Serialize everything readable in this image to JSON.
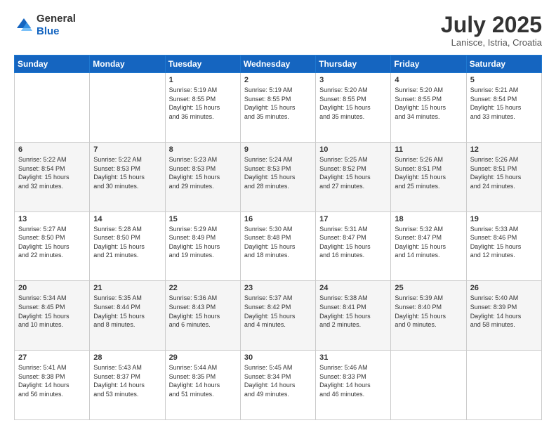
{
  "header": {
    "logo_general": "General",
    "logo_blue": "Blue",
    "month_year": "July 2025",
    "location": "Lanisce, Istria, Croatia"
  },
  "weekdays": [
    "Sunday",
    "Monday",
    "Tuesday",
    "Wednesday",
    "Thursday",
    "Friday",
    "Saturday"
  ],
  "weeks": [
    [
      {
        "day": "",
        "lines": []
      },
      {
        "day": "",
        "lines": []
      },
      {
        "day": "1",
        "lines": [
          "Sunrise: 5:19 AM",
          "Sunset: 8:55 PM",
          "Daylight: 15 hours",
          "and 36 minutes."
        ]
      },
      {
        "day": "2",
        "lines": [
          "Sunrise: 5:19 AM",
          "Sunset: 8:55 PM",
          "Daylight: 15 hours",
          "and 35 minutes."
        ]
      },
      {
        "day": "3",
        "lines": [
          "Sunrise: 5:20 AM",
          "Sunset: 8:55 PM",
          "Daylight: 15 hours",
          "and 35 minutes."
        ]
      },
      {
        "day": "4",
        "lines": [
          "Sunrise: 5:20 AM",
          "Sunset: 8:55 PM",
          "Daylight: 15 hours",
          "and 34 minutes."
        ]
      },
      {
        "day": "5",
        "lines": [
          "Sunrise: 5:21 AM",
          "Sunset: 8:54 PM",
          "Daylight: 15 hours",
          "and 33 minutes."
        ]
      }
    ],
    [
      {
        "day": "6",
        "lines": [
          "Sunrise: 5:22 AM",
          "Sunset: 8:54 PM",
          "Daylight: 15 hours",
          "and 32 minutes."
        ]
      },
      {
        "day": "7",
        "lines": [
          "Sunrise: 5:22 AM",
          "Sunset: 8:53 PM",
          "Daylight: 15 hours",
          "and 30 minutes."
        ]
      },
      {
        "day": "8",
        "lines": [
          "Sunrise: 5:23 AM",
          "Sunset: 8:53 PM",
          "Daylight: 15 hours",
          "and 29 minutes."
        ]
      },
      {
        "day": "9",
        "lines": [
          "Sunrise: 5:24 AM",
          "Sunset: 8:53 PM",
          "Daylight: 15 hours",
          "and 28 minutes."
        ]
      },
      {
        "day": "10",
        "lines": [
          "Sunrise: 5:25 AM",
          "Sunset: 8:52 PM",
          "Daylight: 15 hours",
          "and 27 minutes."
        ]
      },
      {
        "day": "11",
        "lines": [
          "Sunrise: 5:26 AM",
          "Sunset: 8:51 PM",
          "Daylight: 15 hours",
          "and 25 minutes."
        ]
      },
      {
        "day": "12",
        "lines": [
          "Sunrise: 5:26 AM",
          "Sunset: 8:51 PM",
          "Daylight: 15 hours",
          "and 24 minutes."
        ]
      }
    ],
    [
      {
        "day": "13",
        "lines": [
          "Sunrise: 5:27 AM",
          "Sunset: 8:50 PM",
          "Daylight: 15 hours",
          "and 22 minutes."
        ]
      },
      {
        "day": "14",
        "lines": [
          "Sunrise: 5:28 AM",
          "Sunset: 8:50 PM",
          "Daylight: 15 hours",
          "and 21 minutes."
        ]
      },
      {
        "day": "15",
        "lines": [
          "Sunrise: 5:29 AM",
          "Sunset: 8:49 PM",
          "Daylight: 15 hours",
          "and 19 minutes."
        ]
      },
      {
        "day": "16",
        "lines": [
          "Sunrise: 5:30 AM",
          "Sunset: 8:48 PM",
          "Daylight: 15 hours",
          "and 18 minutes."
        ]
      },
      {
        "day": "17",
        "lines": [
          "Sunrise: 5:31 AM",
          "Sunset: 8:47 PM",
          "Daylight: 15 hours",
          "and 16 minutes."
        ]
      },
      {
        "day": "18",
        "lines": [
          "Sunrise: 5:32 AM",
          "Sunset: 8:47 PM",
          "Daylight: 15 hours",
          "and 14 minutes."
        ]
      },
      {
        "day": "19",
        "lines": [
          "Sunrise: 5:33 AM",
          "Sunset: 8:46 PM",
          "Daylight: 15 hours",
          "and 12 minutes."
        ]
      }
    ],
    [
      {
        "day": "20",
        "lines": [
          "Sunrise: 5:34 AM",
          "Sunset: 8:45 PM",
          "Daylight: 15 hours",
          "and 10 minutes."
        ]
      },
      {
        "day": "21",
        "lines": [
          "Sunrise: 5:35 AM",
          "Sunset: 8:44 PM",
          "Daylight: 15 hours",
          "and 8 minutes."
        ]
      },
      {
        "day": "22",
        "lines": [
          "Sunrise: 5:36 AM",
          "Sunset: 8:43 PM",
          "Daylight: 15 hours",
          "and 6 minutes."
        ]
      },
      {
        "day": "23",
        "lines": [
          "Sunrise: 5:37 AM",
          "Sunset: 8:42 PM",
          "Daylight: 15 hours",
          "and 4 minutes."
        ]
      },
      {
        "day": "24",
        "lines": [
          "Sunrise: 5:38 AM",
          "Sunset: 8:41 PM",
          "Daylight: 15 hours",
          "and 2 minutes."
        ]
      },
      {
        "day": "25",
        "lines": [
          "Sunrise: 5:39 AM",
          "Sunset: 8:40 PM",
          "Daylight: 15 hours",
          "and 0 minutes."
        ]
      },
      {
        "day": "26",
        "lines": [
          "Sunrise: 5:40 AM",
          "Sunset: 8:39 PM",
          "Daylight: 14 hours",
          "and 58 minutes."
        ]
      }
    ],
    [
      {
        "day": "27",
        "lines": [
          "Sunrise: 5:41 AM",
          "Sunset: 8:38 PM",
          "Daylight: 14 hours",
          "and 56 minutes."
        ]
      },
      {
        "day": "28",
        "lines": [
          "Sunrise: 5:43 AM",
          "Sunset: 8:37 PM",
          "Daylight: 14 hours",
          "and 53 minutes."
        ]
      },
      {
        "day": "29",
        "lines": [
          "Sunrise: 5:44 AM",
          "Sunset: 8:35 PM",
          "Daylight: 14 hours",
          "and 51 minutes."
        ]
      },
      {
        "day": "30",
        "lines": [
          "Sunrise: 5:45 AM",
          "Sunset: 8:34 PM",
          "Daylight: 14 hours",
          "and 49 minutes."
        ]
      },
      {
        "day": "31",
        "lines": [
          "Sunrise: 5:46 AM",
          "Sunset: 8:33 PM",
          "Daylight: 14 hours",
          "and 46 minutes."
        ]
      },
      {
        "day": "",
        "lines": []
      },
      {
        "day": "",
        "lines": []
      }
    ]
  ]
}
